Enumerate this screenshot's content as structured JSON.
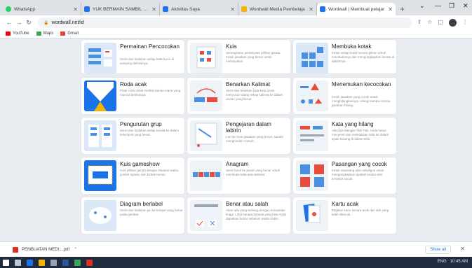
{
  "browser": {
    "tabs": [
      {
        "label": "WhatsApp",
        "color": "#25d366"
      },
      {
        "label": "YUK BERMAIN SAMBIL BELA",
        "color": "#1a73e8"
      },
      {
        "label": "Aktivitas Saya",
        "color": "#1a73e8"
      },
      {
        "label": "Wordwall Media Pembelaja",
        "color": "#f4b400"
      },
      {
        "label": "Wordwall | Membuat pelajar",
        "color": "#1a73e8"
      }
    ],
    "new_tab": "+",
    "url": "wordwall.net/id",
    "bookmarks": [
      {
        "label": "YouTube",
        "color": "#ff0000"
      },
      {
        "label": "Maps",
        "color": "#34a853"
      },
      {
        "label": "Gmail",
        "color": "#ea4335"
      }
    ]
  },
  "templates": [
    {
      "title": "Permainan Pencocokan",
      "desc": "Seret dan letakkan setiap kata kunci di samping definisinya."
    },
    {
      "title": "Kuis",
      "desc": "Serangkaian pertanyaan pilihan ganda. Ketuk jawaban yang benar untuk melanjutkan."
    },
    {
      "title": "Membuka kotak",
      "desc": "Ketuk setiap kotak secara giliran untuk membukanya dan mengungkapkan benda di dalamnya."
    },
    {
      "title": "Roda acak",
      "desc": "Putar roda untuk melihat benda mana yang muncul berikutnya."
    },
    {
      "title": "Benarkan Kalimat",
      "desc": "Seret dan letakkan kata-kata untuk menyusun ulang setiap kalimat ke dalam urutan yang benar."
    },
    {
      "title": "Menemukan kecocokan",
      "desc": "Ketuk jawaban yang cocok untuk menghilangkannya. Ulangi sampai semua jawaban hilang."
    },
    {
      "title": "Pengurutan grup",
      "desc": "Seret dan letakkan setiap benda ke dalam kelompok yang benar."
    },
    {
      "title": "Pengejaran dalam labirin",
      "desc": "Lari ke zona jawaban yang benar, sambil menghindari musuh."
    },
    {
      "title": "Kata yang hilang",
      "desc": "Aktivitas Mengisi Titik-Titik. Anda harus menyeret dan meletakkan kata ke dalam spasi kosong di dalam teks."
    },
    {
      "title": "Kuis gameshow",
      "desc": "Kuis pilihan ganda dengan tekanan waktu, jumlah nyawa, dan babak bonus."
    },
    {
      "title": "Anagram",
      "desc": "Seret huruf ke posisi yang benar untuk membuka kata atau kalimat."
    },
    {
      "title": "Pasangan yang cocok",
      "desc": "Ketuk sepasang ubin sekaligus untuk mengungkapkan apakah kedua ubin tersebut cocok."
    },
    {
      "title": "Diagram berlabel",
      "desc": "Seret dan letakkan pin ke tempat yang benar pada gambar."
    },
    {
      "title": "Benar atau salah",
      "desc": "Akan ada yang terbang dengan kecepatan tinggi. Lihat berapa banyak yang bisa Anda dapatkan benar sebelum waktu habis."
    },
    {
      "title": "Kartu acak",
      "desc": "Bagikan kartu secara acak dari dek yang telah dikocok."
    }
  ],
  "download_bar": {
    "file": "PEMBUATAN MEDI....pdf",
    "show_all": "Show all"
  },
  "taskbar": {
    "lang": "ENG",
    "time": "10:45 AM"
  }
}
